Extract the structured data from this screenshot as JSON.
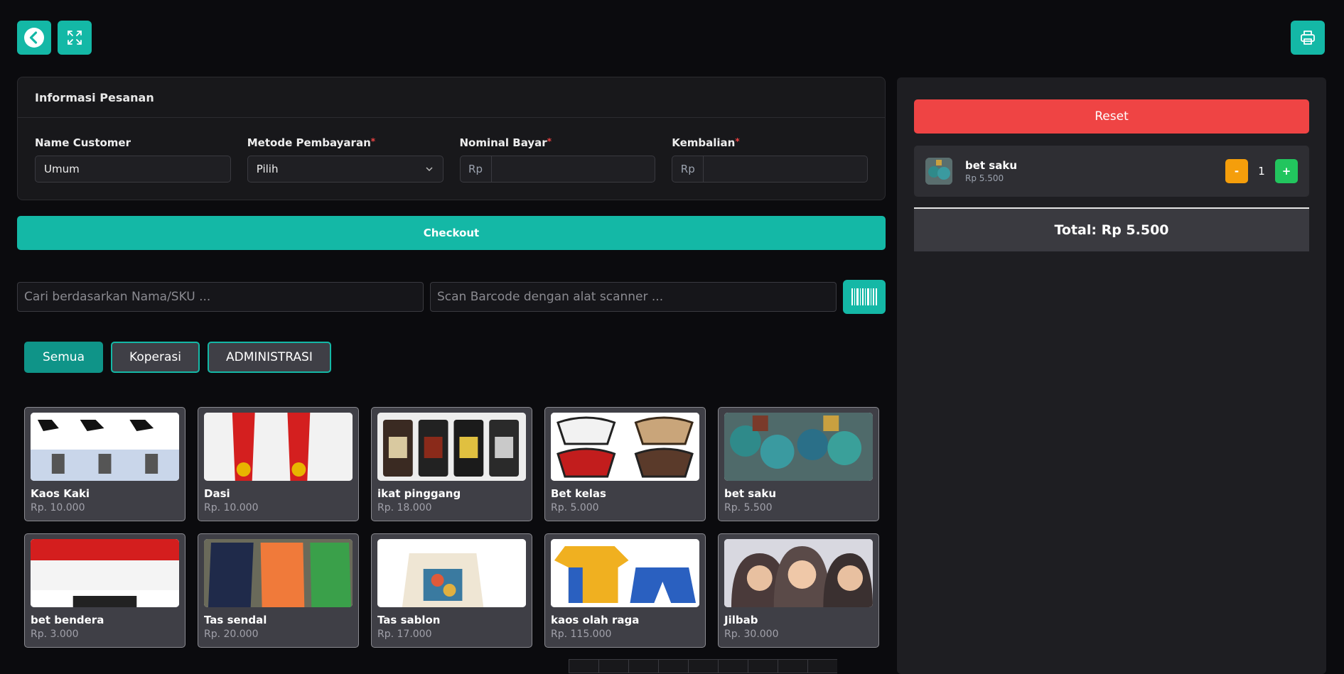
{
  "order": {
    "title": "Informasi Pesanan",
    "customer_label": "Name Customer",
    "customer_value": "Umum",
    "payment_label": "Metode Pembayaran",
    "payment_value": "Pilih",
    "nominal_label": "Nominal Bayar",
    "nominal_prefix": "Rp",
    "change_label": "Kembalian",
    "change_prefix": "Rp",
    "required_mark": "*"
  },
  "checkout_label": "Checkout",
  "search": {
    "name_placeholder": "Cari berdasarkan Nama/SKU ...",
    "barcode_placeholder": "Scan Barcode dengan alat scanner ..."
  },
  "categories": [
    "Semua",
    "Koperasi",
    "ADMINISTRASI"
  ],
  "products": [
    {
      "name": "Kaos Kaki",
      "price": "Rp. 10.000"
    },
    {
      "name": "Dasi",
      "price": "Rp. 10.000"
    },
    {
      "name": "ikat pinggang",
      "price": "Rp. 18.000"
    },
    {
      "name": "Bet kelas",
      "price": "Rp. 5.000"
    },
    {
      "name": "bet saku",
      "price": "Rp. 5.500"
    },
    {
      "name": "bet bendera",
      "price": "Rp. 3.000"
    },
    {
      "name": "Tas sendal",
      "price": "Rp. 20.000"
    },
    {
      "name": "Tas sablon",
      "price": "Rp. 17.000"
    },
    {
      "name": "kaos olah raga",
      "price": "Rp. 115.000"
    },
    {
      "name": "Jilbab",
      "price": "Rp. 30.000"
    }
  ],
  "cart": {
    "reset_label": "Reset",
    "items": [
      {
        "name": "bet saku",
        "price": "Rp 5.500",
        "qty": "1"
      }
    ],
    "minus_label": "-",
    "plus_label": "+",
    "total": "Total: Rp 5.500"
  },
  "icons": {
    "back": "chevron-left-icon",
    "fullscreen": "expand-icon",
    "print": "printer-icon",
    "barcode": "barcode-icon"
  },
  "colors": {
    "accent": "#14b8a6",
    "reset": "#ef4444",
    "minus": "#f59e0b",
    "plus": "#22c55e"
  }
}
